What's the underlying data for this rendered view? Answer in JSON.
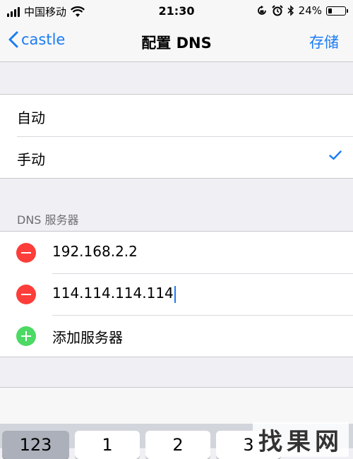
{
  "status_bar": {
    "carrier": "中国移动",
    "time": "21:30",
    "battery_percent": "24%",
    "battery_level": 0.24,
    "icons": [
      "signal-icon",
      "wifi-icon",
      "lock-rotation-icon",
      "alarm-icon",
      "bluetooth-icon",
      "battery-icon"
    ]
  },
  "nav": {
    "back_label": "castle",
    "title": "配置 DNS",
    "save_label": "存储"
  },
  "mode_options": {
    "items": [
      {
        "label": "自动",
        "selected": false
      },
      {
        "label": "手动",
        "selected": true
      }
    ]
  },
  "dns_section": {
    "header": "DNS 服务器",
    "servers": [
      "192.168.2.2",
      "114.114.114.114"
    ],
    "add_label": "添加服务器"
  },
  "keyboard": {
    "keys": [
      "123",
      "1",
      "2",
      "3"
    ]
  },
  "watermark": "找果网",
  "colors": {
    "accent": "#1a7cf5",
    "delete": "#fc3d39",
    "add": "#4cd964"
  }
}
